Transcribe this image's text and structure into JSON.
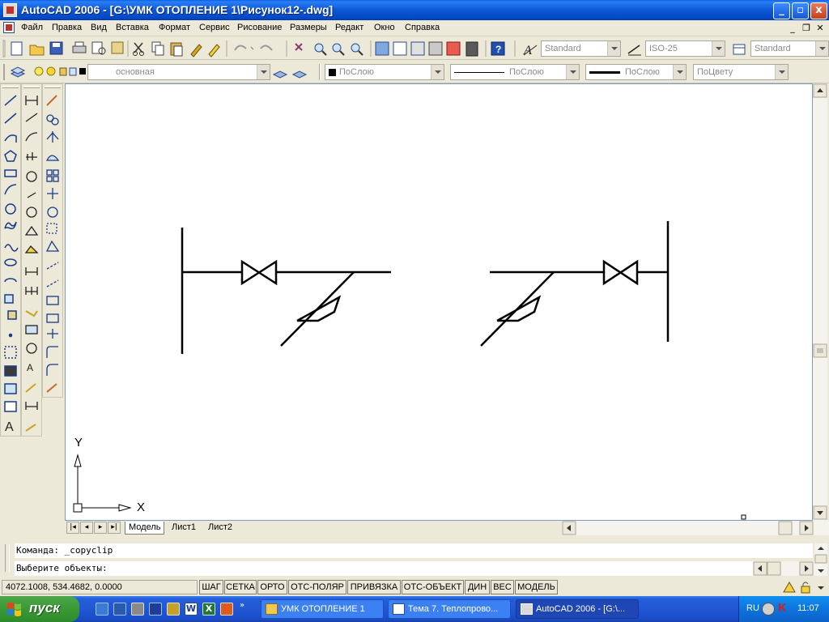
{
  "window": {
    "title": "AutoCAD 2006 - [G:\\УМК ОТОПЛЕНИЕ 1\\Рисунок12-.dwg]",
    "controls": [
      "_",
      "▫",
      "x"
    ]
  },
  "menu": {
    "items": [
      "Файл",
      "Правка",
      "Вид",
      "Вставка",
      "Формат",
      "Сервис",
      "Рисование",
      "Размеры",
      "Редакт",
      "Окно",
      "Справка"
    ]
  },
  "toolbar": {
    "text_style": "Standard",
    "dim_style": "ISO-25",
    "table_style": "Standard"
  },
  "layers": {
    "current_layer": "основная",
    "color": "ПоСлою",
    "linetype": "ПоСлою",
    "lineweight": "ПоСлою",
    "plot_style": "ПоЦвету"
  },
  "canvas": {
    "ucs_x": "X",
    "ucs_y": "Y"
  },
  "tabs": [
    "Модель",
    "Лист1",
    "Лист2"
  ],
  "command": {
    "line1": "Команда: _copyclip",
    "line2": "Выберите объекты:"
  },
  "status": {
    "coords": "4072.1008, 534.4682, 0.0000",
    "buttons": [
      "ШАГ",
      "СЕТКА",
      "ОРТО",
      "ОТС-ПОЛЯР",
      "ПРИВЯЗКА",
      "ОТС-ОБЪЕКТ",
      "ДИН",
      "ВЕС",
      "МОДЕЛЬ"
    ]
  },
  "taskbar": {
    "start": "пуск",
    "tasks": [
      "УМК ОТОПЛЕНИЕ 1",
      "Тема 7. Теплопрово...",
      "AutoCAD 2006 - [G:\\..."
    ],
    "lang": "RU",
    "time": "11:07"
  },
  "colors": {
    "titlebar": "#0c57d6",
    "taskbar": "#245edb",
    "start": "#3b9a36",
    "canvas": "#ffffff"
  }
}
